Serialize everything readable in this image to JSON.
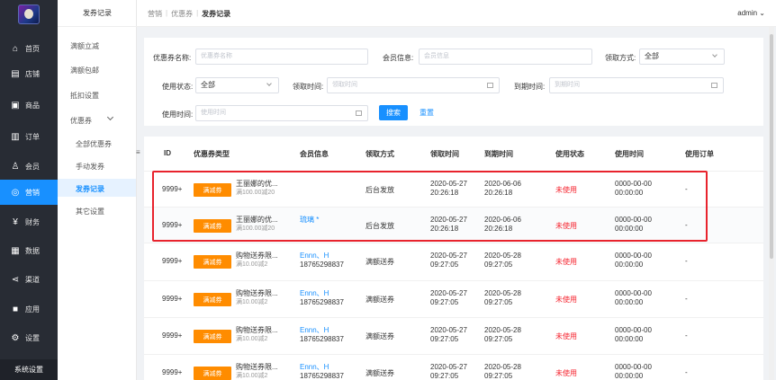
{
  "rail": {
    "items": [
      {
        "label": "首页",
        "icon": "home-icon",
        "glyph": "⌂"
      },
      {
        "label": "店铺",
        "icon": "store-icon",
        "glyph": "▤"
      },
      {
        "label": "商品",
        "icon": "goods-icon",
        "glyph": "▣"
      },
      {
        "label": "订单",
        "icon": "order-icon",
        "glyph": "▥"
      },
      {
        "label": "会员",
        "icon": "member-icon",
        "glyph": "♙"
      },
      {
        "label": "营销",
        "icon": "marketing-icon",
        "glyph": "◎"
      },
      {
        "label": "财务",
        "icon": "finance-icon",
        "glyph": "¥"
      },
      {
        "label": "数据",
        "icon": "data-icon",
        "glyph": "▦"
      },
      {
        "label": "渠道",
        "icon": "channel-icon",
        "glyph": "⋖"
      },
      {
        "label": "应用",
        "icon": "apps-icon",
        "glyph": "■"
      },
      {
        "label": "设置",
        "icon": "settings-icon",
        "glyph": "⚙"
      }
    ],
    "footer": "系统设置"
  },
  "submenu": {
    "title": "发券记录",
    "items": [
      "满额立减",
      "满额包邮",
      "抵扣设置",
      "优惠券"
    ],
    "children": [
      "全部优惠券",
      "手动发券",
      "发券记录",
      "其它设置"
    ]
  },
  "topbar": {
    "breadcrumb": [
      "营销",
      "优惠券",
      "发券记录"
    ],
    "user": "admin"
  },
  "filters": {
    "coupon_name_label": "优惠券名称:",
    "coupon_name_placeholder": "优惠券名称",
    "member_label": "会员信息:",
    "member_placeholder": "会员信息",
    "receive_way_label": "领取方式:",
    "receive_way_value": "全部",
    "status_label": "使用状态:",
    "status_value": "全部",
    "receive_time_label": "领取时间:",
    "receive_time_placeholder": "领取时间",
    "expire_time_label": "到期时间:",
    "expire_time_placeholder": "到期时间",
    "use_time_label": "使用时间:",
    "use_time_placeholder": "使用时间",
    "search": "搜索",
    "reset": "重置"
  },
  "table": {
    "headers": [
      "ID",
      "优惠券类型",
      "会员信息",
      "领取方式",
      "领取时间",
      "到期时间",
      "使用状态",
      "使用时间",
      "使用订单"
    ],
    "rows": [
      {
        "id": "9999+",
        "tag": "满减券",
        "name": "王丽娜的优...",
        "rule": "满100.00减20",
        "member1": "",
        "member2": "",
        "way": "后台发放",
        "recv1": "2020-05-27",
        "recv2": "20:26:18",
        "exp1": "2020-06-06",
        "exp2": "20:26:18",
        "status": "未使用",
        "use1": "0000-00-00",
        "use2": "00:00:00",
        "order": "-"
      },
      {
        "id": "9999+",
        "tag": "满减券",
        "name": "王丽娜的优...",
        "rule": "满100.00减20",
        "member1": "琉璃 *",
        "member2": "",
        "way": "后台发放",
        "recv1": "2020-05-27",
        "recv2": "20:26:18",
        "exp1": "2020-06-06",
        "exp2": "20:26:18",
        "status": "未使用",
        "use1": "0000-00-00",
        "use2": "00:00:00",
        "order": "-"
      },
      {
        "id": "9999+",
        "tag": "满减券",
        "name": "购物送券限...",
        "rule": "满10.00减2",
        "member1": "Ennn、H",
        "member2": "18765298837",
        "way": "满额送券",
        "recv1": "2020-05-27",
        "recv2": "09:27:05",
        "exp1": "2020-05-28",
        "exp2": "09:27:05",
        "status": "未使用",
        "use1": "0000-00-00",
        "use2": "00:00:00",
        "order": "-"
      },
      {
        "id": "9999+",
        "tag": "满减券",
        "name": "购物送券限...",
        "rule": "满10.00减2",
        "member1": "Ennn、H",
        "member2": "18765298837",
        "way": "满额送券",
        "recv1": "2020-05-27",
        "recv2": "09:27:05",
        "exp1": "2020-05-28",
        "exp2": "09:27:05",
        "status": "未使用",
        "use1": "0000-00-00",
        "use2": "00:00:00",
        "order": "-"
      },
      {
        "id": "9999+",
        "tag": "满减券",
        "name": "购物送券限...",
        "rule": "满10.00减2",
        "member1": "Ennn、H",
        "member2": "18765298837",
        "way": "满额送券",
        "recv1": "2020-05-27",
        "recv2": "09:27:05",
        "exp1": "2020-05-28",
        "exp2": "09:27:05",
        "status": "未使用",
        "use1": "0000-00-00",
        "use2": "00:00:00",
        "order": "-"
      },
      {
        "id": "9999+",
        "tag": "满减券",
        "name": "购物送券限...",
        "rule": "满10.00减2",
        "member1": "Ennn、H",
        "member2": "18765298837",
        "way": "满额送券",
        "recv1": "2020-05-27",
        "recv2": "09:27:05",
        "exp1": "2020-05-28",
        "exp2": "09:27:05",
        "status": "未使用",
        "use1": "0000-00-00",
        "use2": "00:00:00",
        "order": "-"
      }
    ]
  },
  "colors": {
    "accent": "#1890ff",
    "tag": "#ff8c00",
    "unused": "#f5222d",
    "highlight": "#e8232d",
    "rail": "#282c34"
  }
}
